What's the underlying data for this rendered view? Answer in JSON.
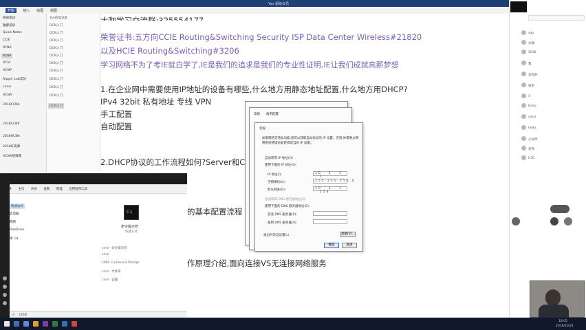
{
  "window": {
    "title": "Yao 超级会员",
    "controls": "– □ ✕"
  },
  "menu": [
    "开始",
    "插入",
    "绘图",
    "视图"
  ],
  "sidebar": {
    "sections": [
      "快速笔记",
      "雅睿培训",
      "Quick Notes",
      "CCIE",
      "RCNA",
      "RCNP",
      "HCIA",
      "HCNP",
      "Ripper Lab实验",
      "Linux",
      "HCNA",
      "2018CCNA",
      "2018CCNP",
      "2018HCNA",
      "2018IE资源",
      "HCNA视频课"
    ],
    "pages": [
      "Yao的笔记本",
      "DCN入门",
      "DCN入门",
      "DCN入门",
      "DCN入门",
      "DCN入门",
      "DCN入门",
      "DCN入门",
      "DCN入门",
      "DCN入门",
      "DCN入门",
      "DCN入门"
    ]
  },
  "note": {
    "heading_fragment": "大咖学习交流群:325554177",
    "line_cert": "荣誉证书:五方向CCIE Routing&Switching Security ISP Data Center Wireless#21820",
    "line_hcie": "以及HCIE Routing&Switching#3206",
    "motto": "学习网络不为了考IE就白学了,IE是我们的追求是我们的专业性证明,IE让我们成就高薪梦想",
    "q1": "1.在企业网中需要使用IP地址的设备有哪些,什么地方用静态地址配置,什么地方用DHCP?",
    "q1_a": "IPv4 32bit 私有地址 专线 VPN",
    "q1_b": "手工配置",
    "q1_c": "自动配置",
    "q2": "2.DHCP协议的工作流程如何?Server和Client",
    "q3_fragment": "的基本配置流程",
    "q4_fragment": "作原理介绍,面向连接VS无连接网络服务"
  },
  "dialog": {
    "title": "常规",
    "tab1": "常规",
    "tab2": "备用配置",
    "desc1": "如果网络支持此功能,则可以获取自动指派的 IP 设置。否则,你需要从网",
    "desc2": "络系统管理员处获得适当的 IP 设置。",
    "auto_ip": "自动获得 IP 地址(O)",
    "manual_ip": "使用下面的 IP 地址(S):",
    "ip_label": "IP 地址(I):",
    "mask_label": "子网掩码(U):",
    "gw_label": "默认网关(D):",
    "ip_value": "10 . 1 . 1 . 1",
    "mask_value": "255.255.255.0",
    "gw_value": "10 . 1 . 1 . 254",
    "auto_dns": "自动获得 DNS 服务器地址(B)",
    "manual_dns": "使用下面的 DNS 服务器地址(E):",
    "dns1_label": "首选 DNS 服务器(P):",
    "dns2_label": "备用 DNS 服务器(A):",
    "validate": "退出时验证设置(L)",
    "advanced": "高级(V)...",
    "ok": "确定",
    "cancel": "取消"
  },
  "explorer": {
    "ribbon": [
      "文件",
      "主页",
      "共享",
      "查看",
      "管理",
      "应用程序工具"
    ],
    "side": [
      "快速访问",
      "此电脑",
      "网络",
      "OneDrive",
      "库 (3)"
    ],
    "file_name": "命令提示符",
    "file_sub": "快捷方式",
    "items": [
      "cmd - 命令提示符",
      "cmd",
      "CMD: Command Prompt",
      "cmd - 文件夹",
      "cmd - 设置"
    ]
  },
  "search": {
    "value": "cmd"
  },
  "taskbar": {
    "time": "18:05",
    "date": "2018/10/21"
  },
  "chat": {
    "items": [
      "yao",
      "大咖",
      "2018",
      "我",
      "没有的",
      "张老",
      "3",
      "Echo",
      "cisco",
      "hello",
      "小伙伴",
      "老师",
      "H3C"
    ]
  },
  "colors": {
    "titlebar": "#1e3f73",
    "purple_text": "#7b5fb6",
    "taskbar": "#10192b"
  }
}
